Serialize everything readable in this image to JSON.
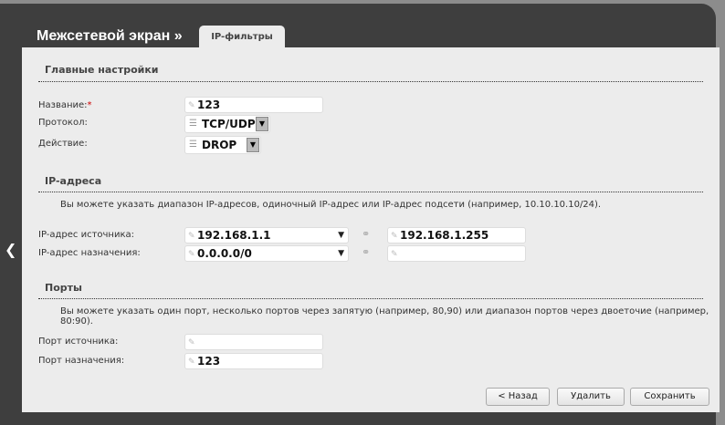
{
  "header": {
    "title": "Межсетевой экран »",
    "tab": "IP-фильтры"
  },
  "main": {
    "title": "Главные настройки",
    "name_label": "Название:",
    "required": "*",
    "name_value": "123",
    "protocol_label": "Протокол:",
    "protocol_value": "TCP/UDP",
    "action_label": "Действие:",
    "action_value": "DROP"
  },
  "ip": {
    "title": "IP-адреса",
    "hint": "Вы можете указать диапазон IP-адресов, одиночный IP-адрес или IP-адрес подсети (например, 10.10.10.10/24).",
    "src_label": "IP-адрес источника:",
    "src_from": "192.168.1.1",
    "src_to": "192.168.1.255",
    "dst_label": "IP-адрес назначения:",
    "dst_from": "0.0.0.0/0",
    "dst_to": ""
  },
  "ports": {
    "title": "Порты",
    "hint": "Вы можете указать один порт, несколько портов через запятую (например, 80,90) или диапазон портов через двоеточие (например, 80:90).",
    "src_label": "Порт источника:",
    "src_value": "",
    "dst_label": "Порт назначения:",
    "dst_value": "123"
  },
  "buttons": {
    "back": "< Назад",
    "delete": "Удалить",
    "save": "Сохранить"
  }
}
